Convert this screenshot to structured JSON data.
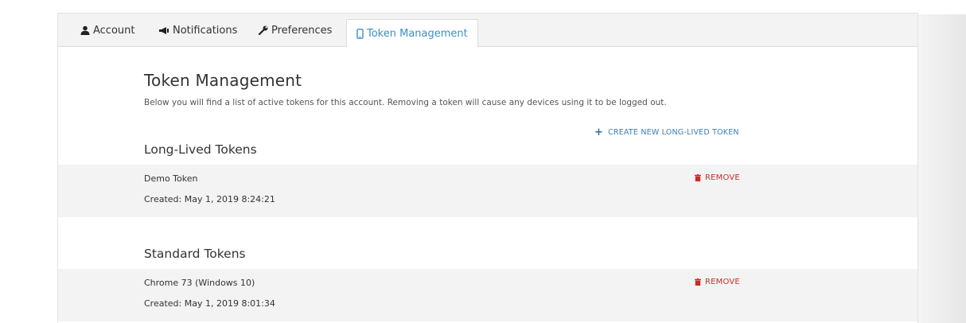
{
  "tabs": [
    {
      "label": "Account",
      "icon": "user-icon"
    },
    {
      "label": "Notifications",
      "icon": "megaphone-icon"
    },
    {
      "label": "Preferences",
      "icon": "wrench-icon"
    },
    {
      "label": "Token Management",
      "icon": "mobile-icon",
      "active": true
    }
  ],
  "page": {
    "title": "Token Management",
    "description": "Below you will find a list of active tokens for this account. Removing a token will cause any devices using it to be logged out.",
    "create_label": "CREATE NEW LONG-LIVED TOKEN"
  },
  "long_lived": {
    "title": "Long-Lived Tokens",
    "tokens": [
      {
        "name": "Demo Token",
        "created": "Created: May 1, 2019 8:24:21",
        "remove_label": "REMOVE"
      }
    ]
  },
  "standard": {
    "title": "Standard Tokens",
    "tokens": [
      {
        "name": "Chrome 73 (Windows 10)",
        "created": "Created: May 1, 2019 8:01:34",
        "remove_label": "REMOVE"
      }
    ]
  },
  "colors": {
    "accent": "#3b8fc6",
    "danger": "#cf2a2a"
  }
}
